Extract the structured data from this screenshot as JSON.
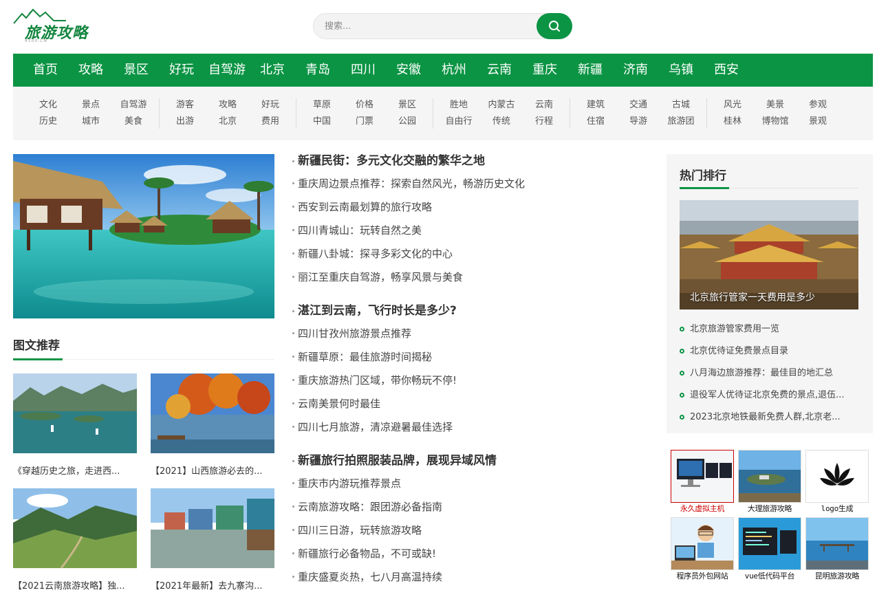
{
  "header": {
    "logo_text": "旅游攻略",
    "logo_sub": "4100.CN",
    "search_placeholder": "搜索..."
  },
  "nav": [
    "首页",
    "攻略",
    "景区",
    "好玩",
    "自驾游",
    "北京",
    "青岛",
    "四川",
    "安徽",
    "杭州",
    "云南",
    "重庆",
    "新疆",
    "济南",
    "乌镇",
    "西安"
  ],
  "subnav": [
    [
      "文化",
      "景点",
      "自驾游",
      "历史",
      "城市",
      "美食"
    ],
    [
      "游客",
      "攻略",
      "好玩",
      "出游",
      "北京",
      "费用"
    ],
    [
      "草原",
      "价格",
      "景区",
      "中国",
      "门票",
      "公园"
    ],
    [
      "胜地",
      "内蒙古",
      "云南",
      "自由行",
      "传统",
      "行程"
    ],
    [
      "建筑",
      "交通",
      "古城",
      "住宿",
      "导游",
      "旅游团"
    ],
    [
      "风光",
      "美景",
      "参观",
      "桂林",
      "博物馆",
      "景观"
    ]
  ],
  "left": {
    "section_title": "图文推荐",
    "thumbs": [
      {
        "caption": "《穿越历史之旅，走进西..."
      },
      {
        "caption": "【2021】山西旅游必去的..."
      },
      {
        "caption": "【2021云南旅游攻略】独..."
      },
      {
        "caption": "【2021年最新】去九寨沟..."
      }
    ]
  },
  "articles": [
    {
      "head": "新疆民街：多元文化交融的繁华之地",
      "items": [
        "重庆周边景点推荐：探索自然风光，畅游历史文化",
        "西安到云南最划算的旅行攻略",
        "四川青城山：玩转自然之美",
        "新疆八卦城：探寻多彩文化的中心",
        "丽江至重庆自驾游，畅享风景与美食"
      ]
    },
    {
      "head": "湛江到云南，飞行时长是多少?",
      "items": [
        "四川甘孜州旅游景点推荐",
        "新疆草原：最佳旅游时间揭秘",
        "重庆旅游热门区域，带你畅玩不停!",
        "云南美景何时最佳",
        "四川七月旅游，清凉避暑最佳选择"
      ]
    },
    {
      "head": "新疆旅行拍照服装品牌，展现异域风情",
      "items": [
        "重庆市内游玩推荐景点",
        "云南旅游攻略：跟团游必备指南",
        "四川三日游，玩转旅游攻略",
        "新疆旅行必备物品，不可或缺!",
        "重庆盛夏炎热，七八月高温持续"
      ]
    }
  ],
  "sidebar": {
    "title": "热门排行",
    "feature_caption": "北京旅行管家一天费用是多少",
    "hot": [
      "北京旅游管家费用一览",
      "北京优待证免费景点目录",
      "八月海边旅游推荐：最佳目的地汇总",
      "退役军人优待证北京免费的景点,退伍...",
      "2023北京地铁最新免费人群,北京老..."
    ]
  },
  "ads": [
    "永久虚拟主机",
    "大理旅游攻略",
    "logo生成",
    "程序员外包网站",
    "vue低代码平台",
    "昆明旅游攻略"
  ],
  "colors": {
    "brand_green": "#0b9444",
    "ad_highlight": "#cc0000"
  }
}
